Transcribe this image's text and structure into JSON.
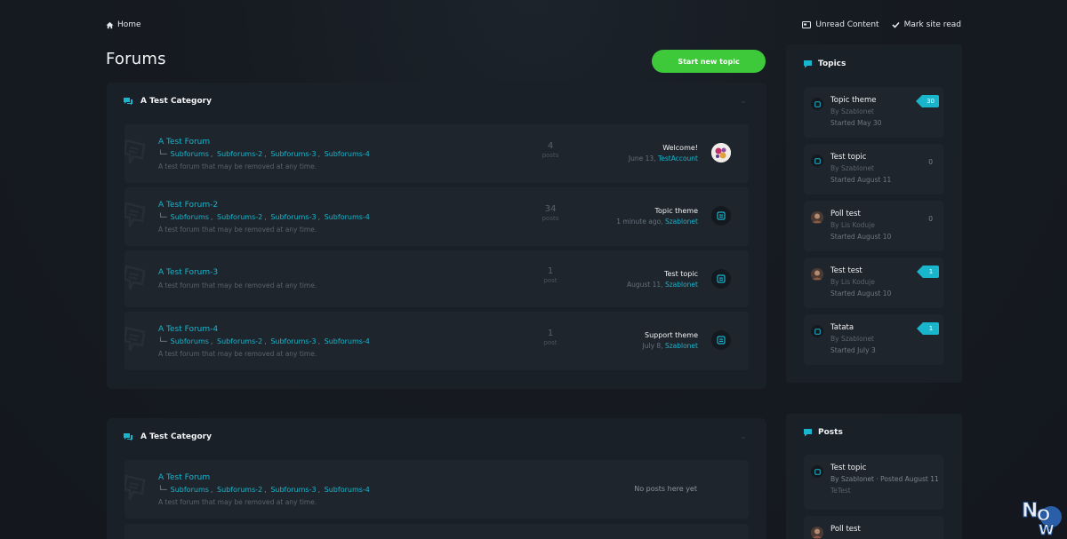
{
  "topbar": {
    "home": "Home",
    "unread": "Unread Content",
    "mark_read": "Mark site read"
  },
  "page": {
    "title": "Forums",
    "start_button": "Start new topic"
  },
  "categories": [
    {
      "name": "A Test Category",
      "forums": [
        {
          "title": "A Test Forum",
          "subforums": [
            "Subforums",
            "Subforums-2",
            "Subforums-3",
            "Subforums-4"
          ],
          "desc": "A test forum that may be removed at any time.",
          "count": "4",
          "count_label": "posts",
          "last_title": "Welcome!",
          "last_date": "June 13,",
          "last_author": "TestAccount"
        },
        {
          "title": "A Test Forum-2",
          "subforums": [
            "Subforums",
            "Subforums-2",
            "Subforums-3",
            "Subforums-4"
          ],
          "desc": "A test forum that may be removed at any time.",
          "count": "34",
          "count_label": "posts",
          "last_title": "Topic theme",
          "last_date": "1 minute ago,",
          "last_author": "Szablonet"
        },
        {
          "title": "A Test Forum-3",
          "desc": "A test forum that may be removed at any time.",
          "count": "1",
          "count_label": "post",
          "last_title": "Test topic",
          "last_date": "August 11,",
          "last_author": "Szablonet"
        },
        {
          "title": "A Test Forum-4",
          "subforums": [
            "Subforums",
            "Subforums-2",
            "Subforums-3",
            "Subforums-4"
          ],
          "desc": "A test forum that may be removed at any time.",
          "count": "1",
          "count_label": "post",
          "last_title": "Support theme",
          "last_date": "July 8,",
          "last_author": "Szablonet"
        }
      ]
    },
    {
      "name": "A Test Category",
      "forums": [
        {
          "title": "A Test Forum",
          "subforums": [
            "Subforums",
            "Subforums-2",
            "Subforums-3",
            "Subforums-4"
          ],
          "desc": "A test forum that may be removed at any time.",
          "no_posts": "No posts here yet"
        }
      ]
    }
  ],
  "sidebar_topics": {
    "heading": "Topics",
    "items": [
      {
        "title": "Topic theme",
        "by": "By Szablonet",
        "started": "Started May 30",
        "count": "30",
        "highlight": true
      },
      {
        "title": "Test topic",
        "by": "By Szablonet",
        "started": "Started August 11",
        "count": "0",
        "highlight": false
      },
      {
        "title": "Poll test",
        "by": "By Lis Koduje",
        "started": "Started August 10",
        "count": "0",
        "highlight": false
      },
      {
        "title": "Test test",
        "by": "By Lis Koduje",
        "started": "Started August 10",
        "count": "1",
        "highlight": true
      },
      {
        "title": "Tatata",
        "by": "By Szablonet",
        "started": "Started July 3",
        "count": "1",
        "highlight": true
      }
    ]
  },
  "sidebar_posts": {
    "heading": "Posts",
    "items": [
      {
        "title": "Test topic",
        "by": "By Szablonet",
        "posted": "· Posted August 11",
        "excerpt": "TeTest"
      },
      {
        "title": "Poll test"
      }
    ]
  },
  "colors": {
    "accent": "#19b5cc",
    "button": "#3ec93a",
    "panel": "#1a2028",
    "row": "#1e252d"
  }
}
